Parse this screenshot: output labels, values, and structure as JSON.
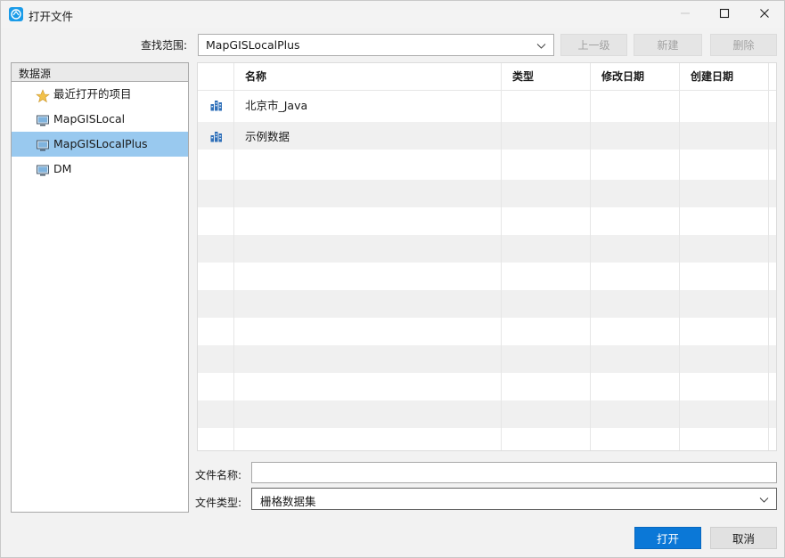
{
  "window": {
    "title": "打开文件",
    "icons": {
      "app": "mapgis-app-icon",
      "minimize": "minimize-icon",
      "maximize": "maximize-icon",
      "close": "close-icon"
    }
  },
  "lookin": {
    "label": "查找范围:",
    "value": "MapGISLocalPlus"
  },
  "toolbar": {
    "up_label": "上一级",
    "new_label": "新建",
    "delete_label": "删除"
  },
  "datasource": {
    "header": "数据源",
    "items": [
      {
        "label": "最近打开的项目",
        "icon": "star-icon"
      },
      {
        "label": "MapGISLocal",
        "icon": "computer-icon"
      },
      {
        "label": "MapGISLocalPlus",
        "icon": "computer-icon",
        "selected": true
      },
      {
        "label": "DM",
        "icon": "computer-icon"
      }
    ]
  },
  "filelist": {
    "columns": [
      "名称",
      "类型",
      "修改日期",
      "创建日期"
    ],
    "rows": [
      {
        "name": "北京市_Java",
        "icon": "database-icon"
      },
      {
        "name": "示例数据",
        "icon": "database-icon"
      }
    ]
  },
  "filename": {
    "label": "文件名称:",
    "value": ""
  },
  "filetype": {
    "label": "文件类型:",
    "value": "栅格数据集"
  },
  "buttons": {
    "open_label": "打开",
    "cancel_label": "取消"
  },
  "colors": {
    "accent": "#0b78d7",
    "selection": "#99c9ef"
  }
}
